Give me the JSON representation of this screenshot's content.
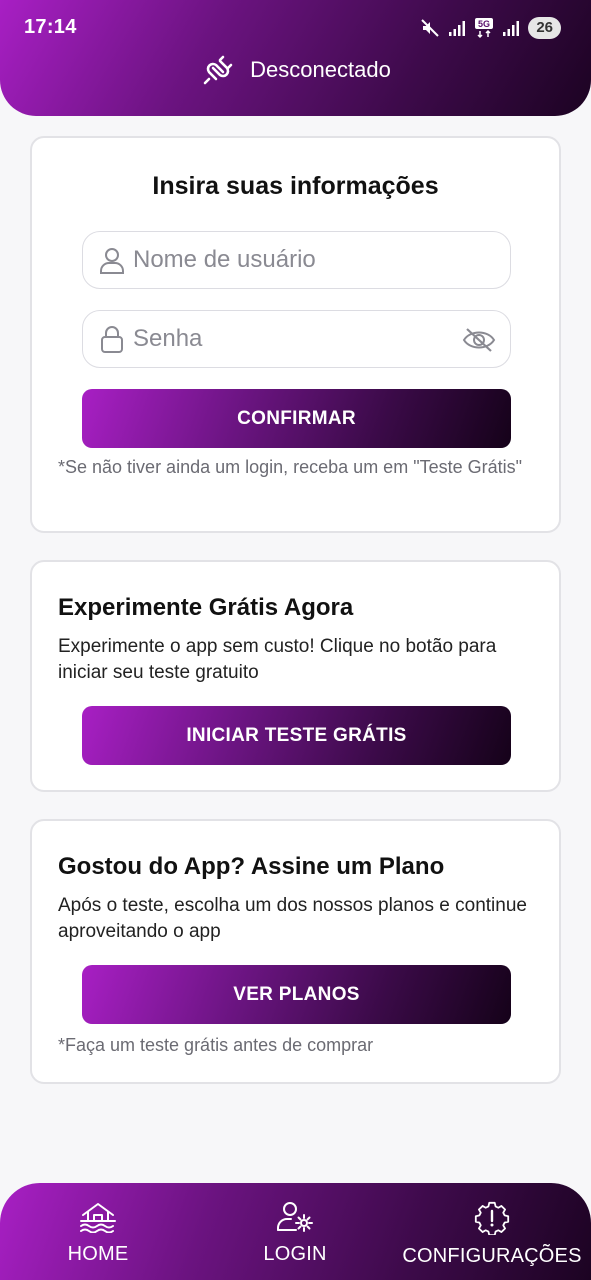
{
  "status_bar": {
    "time": "17:14",
    "battery": "26",
    "network": "5G"
  },
  "header": {
    "connection_status": "Desconectado"
  },
  "login_card": {
    "title": "Insira suas informações",
    "username_placeholder": "Nome de usuário",
    "password_placeholder": "Senha",
    "confirm_label": "CONFIRMAR",
    "note": "*Se não tiver ainda um login, receba um em \"Teste Grátis\""
  },
  "trial_card": {
    "title": "Experimente Grátis Agora",
    "text": "Experimente o app sem custo! Clique no botão para iniciar seu teste gratuito",
    "button_label": "INICIAR TESTE GRÁTIS"
  },
  "plan_card": {
    "title": "Gostou do App? Assine um Plano",
    "text": "Após o teste, escolha um dos nossos planos e continue aproveitando o app",
    "button_label": "VER PLANOS",
    "note": "*Faça um teste grátis antes de comprar"
  },
  "bottom_nav": {
    "items": [
      {
        "label": "HOME",
        "icon": "home-icon"
      },
      {
        "label": "LOGIN",
        "icon": "user-settings-icon"
      },
      {
        "label": "CONFIGURAÇÕES",
        "icon": "gear-alert-icon"
      }
    ]
  },
  "colors": {
    "gradient_start": "#a81fc4",
    "gradient_end": "#1c0322",
    "background": "#f7f7f9"
  }
}
